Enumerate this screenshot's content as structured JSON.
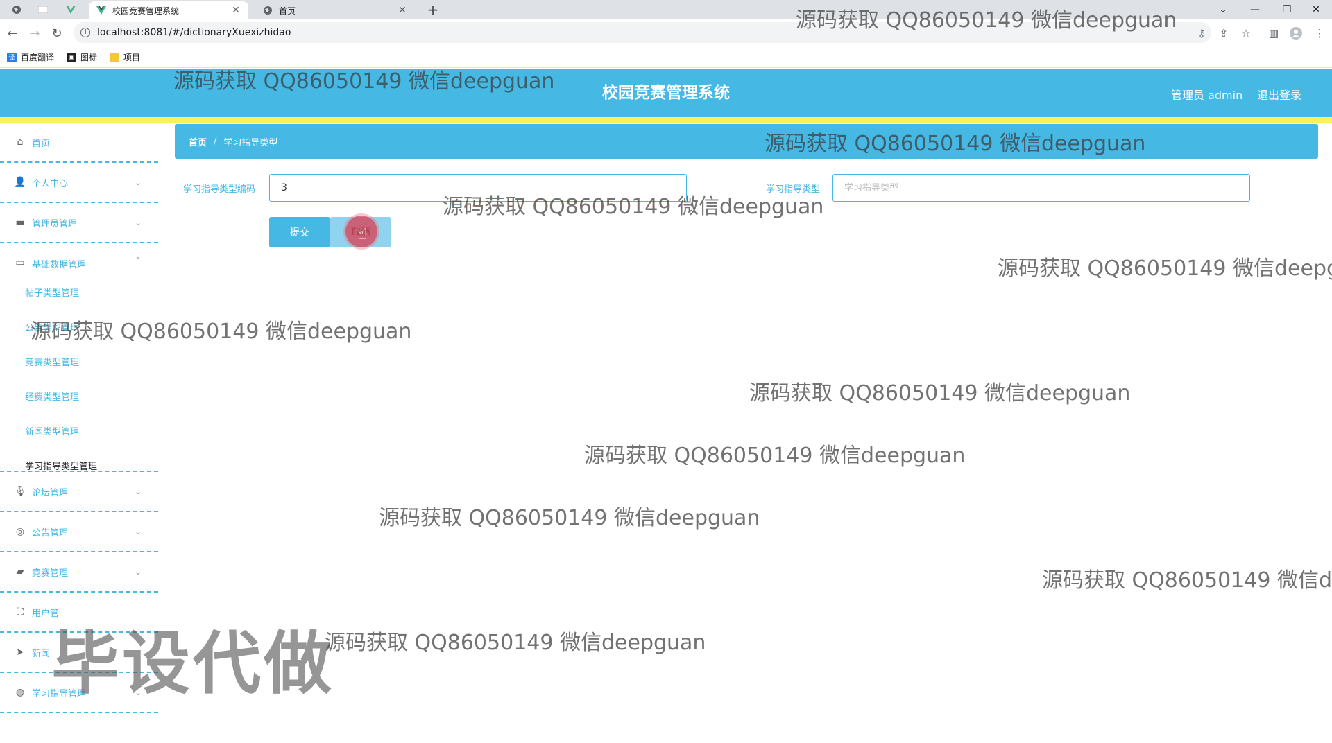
{
  "browser": {
    "tabs": [
      {
        "title": "校园竞赛管理系统",
        "active": true
      },
      {
        "title": "首页",
        "active": false
      }
    ],
    "new_tab": "+",
    "url": "localhost:8081/#/dictionaryXuexizhidao",
    "bookmarks": [
      {
        "label": "百度翻译",
        "icon": "translate-icon",
        "color": "#2b7de9"
      },
      {
        "label": "图标",
        "icon": "image-icon",
        "color": "#222222"
      },
      {
        "label": "项目",
        "icon": "folder-icon",
        "color": "#f5c542"
      }
    ]
  },
  "header": {
    "title": "校园竞赛管理系统",
    "user_label": "管理员 admin",
    "logout_label": "退出登录"
  },
  "sidebar": {
    "items": [
      {
        "label": "首页",
        "icon": "home-icon"
      },
      {
        "label": "个人中心",
        "icon": "user-icon"
      },
      {
        "label": "管理员管理",
        "icon": "admin-icon"
      },
      {
        "label": "基础数据管理",
        "icon": "card-icon"
      },
      {
        "label": "论坛管理",
        "icon": "mic-icon"
      },
      {
        "label": "公告管理",
        "icon": "compass-icon"
      },
      {
        "label": "竞赛管理",
        "icon": "briefcase-icon"
      },
      {
        "label": "用户管",
        "icon": "fullscreen-icon"
      },
      {
        "label": "新闻",
        "icon": "send-icon"
      },
      {
        "label": "学习指导管理",
        "icon": "globe-icon"
      }
    ],
    "sub_items": [
      {
        "label": "帖子类型管理",
        "active": false
      },
      {
        "label": "公告类型管理",
        "active": false
      },
      {
        "label": "竞赛类型管理",
        "active": false
      },
      {
        "label": "经费类型管理",
        "active": false
      },
      {
        "label": "新闻类型管理",
        "active": false
      },
      {
        "label": "学习指导类型管理",
        "active": true
      }
    ]
  },
  "breadcrumb": {
    "home": "首页",
    "separator": "/",
    "current": "学习指导类型"
  },
  "form": {
    "code_label": "学习指导类型编码",
    "code_value": "3",
    "type_label": "学习指导类型",
    "type_placeholder": "学习指导类型",
    "submit_label": "提交",
    "cancel_label": "取消"
  },
  "watermark": {
    "text": "源码获取 QQ86050149 微信deepguan",
    "big_text": "毕设代做"
  },
  "colors": {
    "primary": "#45b8e4",
    "accent_bar": "#f7f25a"
  }
}
